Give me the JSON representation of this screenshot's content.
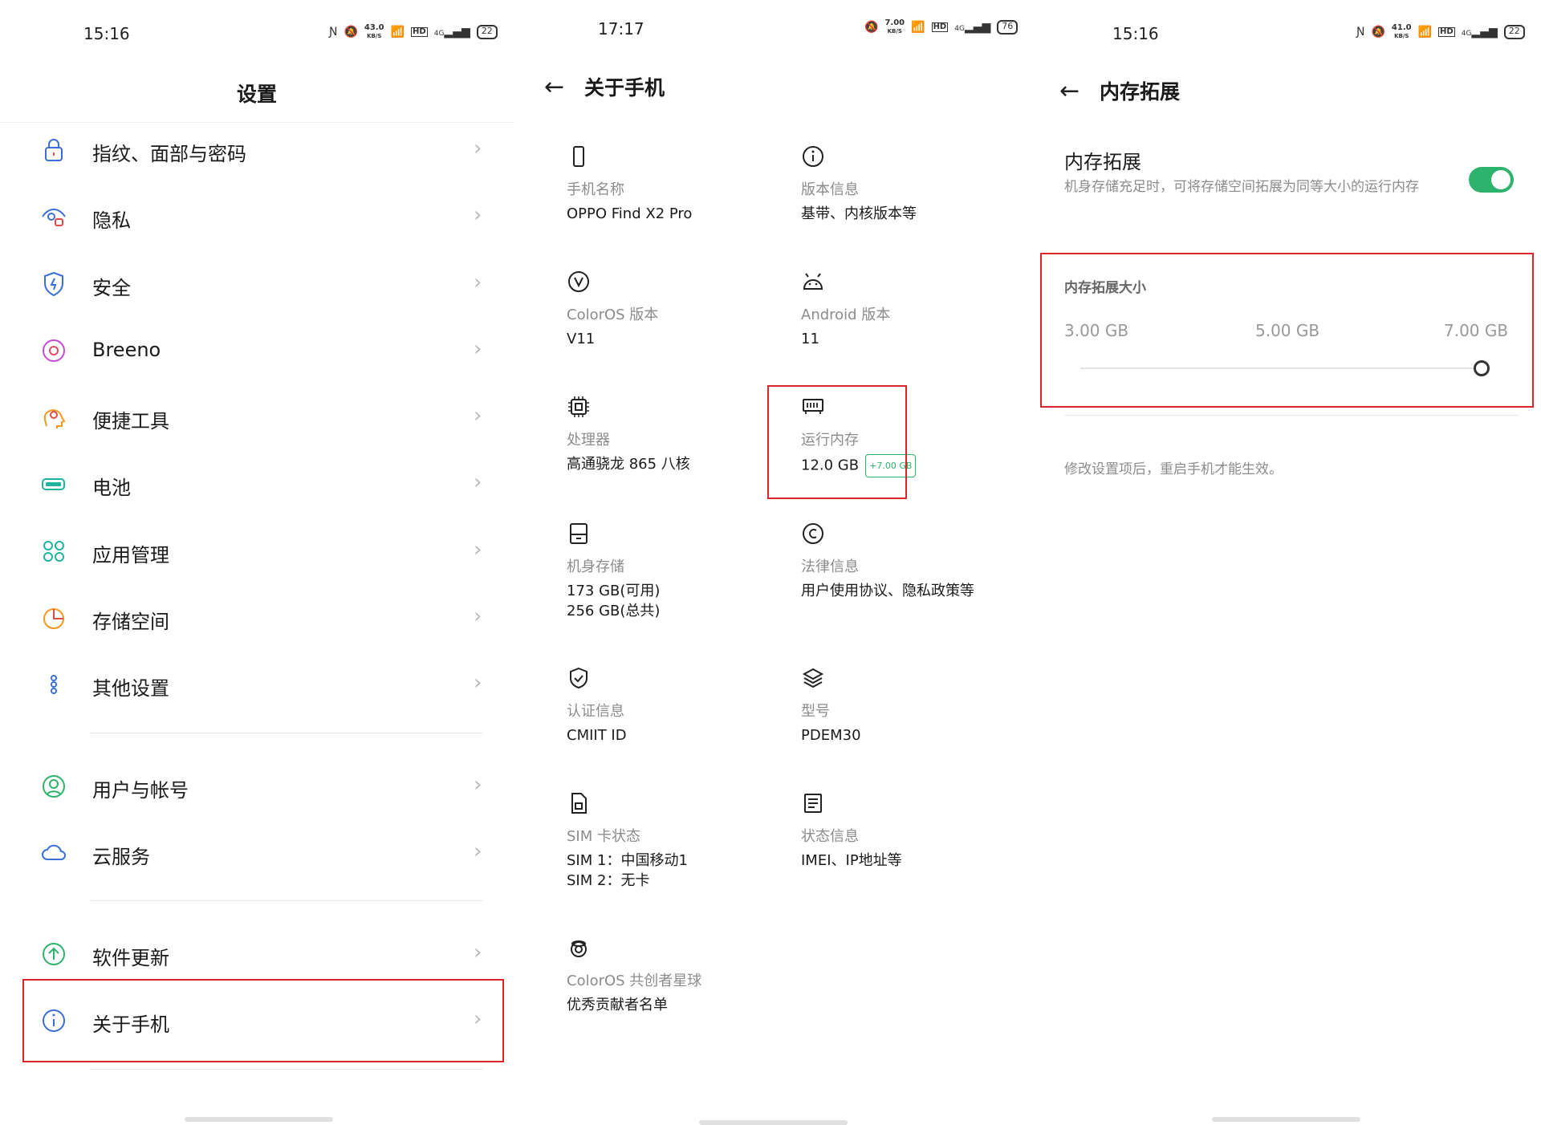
{
  "screen1": {
    "status": {
      "time": "15:16",
      "speed": "43.0",
      "speed_unit": "KB/S",
      "battery": "22",
      "hd": "HD",
      "net": "4G"
    },
    "title": "设置",
    "items": [
      {
        "label": "指纹、面部与密码",
        "icon": "lock-icon"
      },
      {
        "label": "隐私",
        "icon": "eye-lock-icon"
      },
      {
        "label": "安全",
        "icon": "shield-bolt-icon"
      },
      {
        "label": "Breeno",
        "icon": "breeno-ring-icon"
      },
      {
        "label": "便捷工具",
        "icon": "head-gear-icon"
      },
      {
        "label": "电池",
        "icon": "battery-icon"
      },
      {
        "label": "应用管理",
        "icon": "apps-grid-icon"
      },
      {
        "label": "存储空间",
        "icon": "pie-chart-icon"
      },
      {
        "label": "其他设置",
        "icon": "dots-vertical-icon"
      },
      {
        "label": "用户与帐号",
        "icon": "user-circle-icon"
      },
      {
        "label": "云服务",
        "icon": "cloud-icon"
      },
      {
        "label": "软件更新",
        "icon": "arrow-up-circle-icon"
      },
      {
        "label": "关于手机",
        "icon": "info-circle-icon"
      }
    ]
  },
  "screen2": {
    "status": {
      "time": "17:17",
      "speed": "7.00",
      "speed_unit": "KB/S",
      "battery": "76",
      "hd": "HD",
      "net": "4G"
    },
    "title": "关于手机",
    "cells": [
      {
        "label": "手机名称",
        "value": "OPPO Find X2 Pro",
        "icon": "phone-icon"
      },
      {
        "label": "版本信息",
        "value": "基带、内核版本等",
        "icon": "info-icon"
      },
      {
        "label": "ColorOS 版本",
        "value": "V11",
        "icon": "v-circle-icon"
      },
      {
        "label": "Android 版本",
        "value": "11",
        "icon": "android-icon"
      },
      {
        "label": "处理器",
        "value": "高通骁龙 865 八核",
        "icon": "chip-icon"
      },
      {
        "label": "运行内存",
        "value": "12.0 GB",
        "badge": "+7.00 GB",
        "icon": "memory-icon"
      },
      {
        "label": "机身存储",
        "value": "173 GB(可用)",
        "value2": "256 GB(总共)",
        "icon": "storage-icon"
      },
      {
        "label": "法律信息",
        "value": "用户使用协议、隐私政策等",
        "icon": "copyright-icon"
      },
      {
        "label": "认证信息",
        "value": "CMIIT ID",
        "icon": "shield-check-icon"
      },
      {
        "label": "型号",
        "value": "PDEM30",
        "icon": "layers-icon"
      },
      {
        "label": "SIM 卡状态",
        "value": "SIM 1：中国移动1",
        "value2": "SIM 2：无卡",
        "icon": "sim-icon"
      },
      {
        "label": "状态信息",
        "value": "IMEI、IP地址等",
        "icon": "document-icon"
      },
      {
        "label": "ColorOS 共创者星球",
        "value": "优秀贡献者名单",
        "icon": "planet-icon"
      }
    ]
  },
  "screen3": {
    "status": {
      "time": "15:16",
      "speed": "41.0",
      "speed_unit": "KB/S",
      "battery": "22",
      "hd": "HD",
      "net": "4G"
    },
    "title": "内存拓展",
    "setting_title": "内存拓展",
    "setting_desc": "机身存储充足时，可将存储空间拓展为同等大小的运行内存",
    "toggle_on": true,
    "size_title": "内存拓展大小",
    "options": [
      "3.00 GB",
      "5.00 GB",
      "7.00 GB"
    ],
    "selected_option": "7.00 GB",
    "note": "修改设置项后，重启手机才能生效。"
  },
  "colors": {
    "accent_green": "#2db36b",
    "highlight_red": "#d9262c",
    "label_grey": "#8c8c8c"
  }
}
